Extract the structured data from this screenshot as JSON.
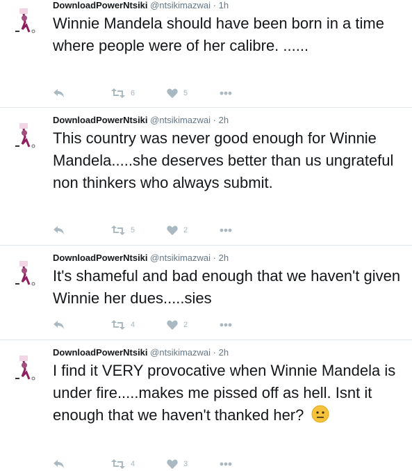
{
  "tweets": [
    {
      "display_name": "DownloadPowerNtsiki",
      "handle": "@ntsikimazwai",
      "dot": "·",
      "time": "1h",
      "text": "Winnie Mandela should have been born in a time where people were of  her calibre. ......",
      "retweets": "6",
      "likes": "5"
    },
    {
      "display_name": "DownloadPowerNtsiki",
      "handle": "@ntsikimazwai",
      "dot": "·",
      "time": "2h",
      "text": "This country was never good enough for Winnie Mandela.....she deserves better than us ungrateful non thinkers who always submit.",
      "retweets": "5",
      "likes": "2"
    },
    {
      "display_name": "DownloadPowerNtsiki",
      "handle": "@ntsikimazwai",
      "dot": "·",
      "time": "2h",
      "text": "It's shameful and bad enough that we haven't given Winnie her dues.....sies",
      "retweets": "4",
      "likes": "2"
    },
    {
      "display_name": "DownloadPowerNtsiki",
      "handle": "@ntsikimazwai",
      "dot": "·",
      "time": "2h",
      "text": "I find it VERY provocative when Winnie Mandela is under fire.....makes me pissed off as hell. Isnt it enough that we haven't thanked her?",
      "retweets": "4",
      "likes": "3"
    }
  ],
  "icons": {
    "reply": "reply-icon",
    "retweet": "retweet-icon",
    "like": "heart-icon",
    "more": "more-icon",
    "emoji": "neutral-face-emoji"
  },
  "colors": {
    "action_icon": "#aab8c2",
    "divider": "#e1e8ed",
    "meta_text": "#657786"
  }
}
